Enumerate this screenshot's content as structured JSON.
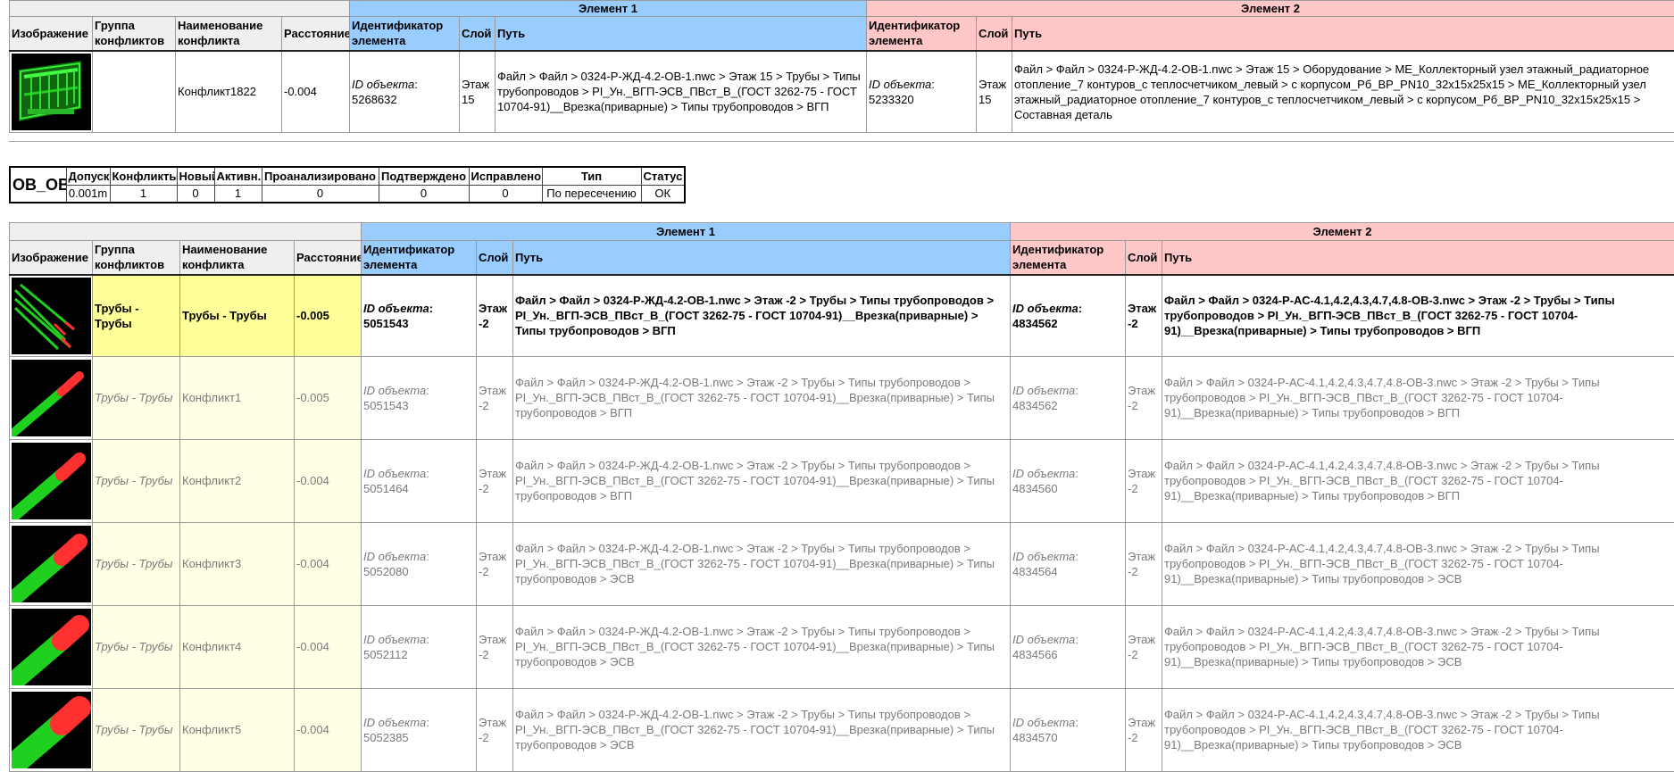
{
  "labels": {
    "element1": "Элемент 1",
    "element2": "Элемент 2",
    "image": "Изображение",
    "group": "Группа конфликтов",
    "name": "Наименование конфликта",
    "distance": "Расстояние",
    "element_id": "Идентификатор элемента",
    "layer": "Слой",
    "path": "Путь",
    "object_id": "ID объекта",
    "colon": ":"
  },
  "top_row": {
    "group": "",
    "name": "Конфликт1822",
    "distance": "-0.004",
    "e1_id": "5268632",
    "e1_layer": "Этаж 15",
    "e1_path": "Файл > Файл > 0324-Р-ЖД-4.2-ОВ-1.nwc > Этаж 15 > Трубы > Типы трубопроводов > PI_Ун._ВГП-ЭСВ_ПВст_В_(ГОСТ 3262-75 - ГОСТ 10704-91)__Врезка(приварные) > Типы трубопроводов > ВГП",
    "e2_id": "5233320",
    "e2_layer": "Этаж 15",
    "e2_path": "Файл > Файл > 0324-Р-ЖД-4.2-ОВ-1.nwc > Этаж 15 > Оборудование > МЕ_Коллекторный узел этажный_радиаторное отопление_7 контуров_с теплосчетчиком_левый > с корпусом_Рб_ВР_PN10_32x15x25x15 > МЕ_Коллекторный узел этажный_радиаторное отопление_7 контуров_с теплосчетчиком_левый > с корпусом_Рб_ВР_PN10_32x15x25x15 > Составная деталь"
  },
  "summary": {
    "name": "ОВ_ОВ",
    "headers": [
      "Допуск",
      "Конфликты",
      "Новый",
      "Активн.",
      "Проанализировано",
      "Подтверждено",
      "Исправлено",
      "Тип",
      "Статус"
    ],
    "values": [
      "0.001m",
      "1",
      "0",
      "1",
      "0",
      "0",
      "0",
      "По пересечению",
      "ОК"
    ]
  },
  "group_row": {
    "group": "Трубы - Трубы",
    "name": "",
    "distance": "-0.005",
    "e1_id": "5051543",
    "e1_layer": "Этаж -2",
    "e1_path": "Файл > Файл > 0324-Р-ЖД-4.2-ОВ-1.nwc > Этаж -2 > Трубы > Типы трубопроводов > PI_Ун._ВГП-ЭСВ_ПВст_В_(ГОСТ 3262-75 - ГОСТ 10704-91)__Врезка(приварные) > Типы трубопроводов > ВГП",
    "e2_id": "4834562",
    "e2_layer": "Этаж -2",
    "e2_path": "Файл > Файл > 0324-Р-АС-4.1,4.2,4.3,4.7,4.8-ОВ-3.nwc > Этаж -2 > Трубы > Типы трубопроводов > PI_Ун._ВГП-ЭСВ_ПВст_В_(ГОСТ 3262-75 - ГОСТ 10704-91)__Врезка(приварные) > Типы трубопроводов > ВГП"
  },
  "rows": [
    {
      "group": "Трубы - Трубы",
      "name": "Конфликт1",
      "distance": "-0.005",
      "e1_id": "5051543",
      "e1_layer": "Этаж -2",
      "e1_path": "Файл > Файл > 0324-Р-ЖД-4.2-ОВ-1.nwc > Этаж -2 > Трубы > Типы трубопроводов > PI_Ун._ВГП-ЭСВ_ПВст_В_(ГОСТ 3262-75 - ГОСТ 10704-91)__Врезка(приварные) > Типы трубопроводов > ВГП",
      "e2_id": "4834562",
      "e2_layer": "Этаж -2",
      "e2_path": "Файл > Файл > 0324-Р-АС-4.1,4.2,4.3,4.7,4.8-ОВ-3.nwc > Этаж -2 > Трубы > Типы трубопроводов > PI_Ун._ВГП-ЭСВ_ПВст_В_(ГОСТ 3262-75 - ГОСТ 10704-91)__Врезка(приварные) > Типы трубопроводов > ВГП"
    },
    {
      "group": "Трубы - Трубы",
      "name": "Конфликт2",
      "distance": "-0.004",
      "e1_id": "5051464",
      "e1_layer": "Этаж -2",
      "e1_path": "Файл > Файл > 0324-Р-ЖД-4.2-ОВ-1.nwc > Этаж -2 > Трубы > Типы трубопроводов > PI_Ун._ВГП-ЭСВ_ПВст_В_(ГОСТ 3262-75 - ГОСТ 10704-91)__Врезка(приварные) > Типы трубопроводов > ВГП",
      "e2_id": "4834560",
      "e2_layer": "Этаж -2",
      "e2_path": "Файл > Файл > 0324-Р-АС-4.1,4.2,4.3,4.7,4.8-ОВ-3.nwc > Этаж -2 > Трубы > Типы трубопроводов > PI_Ун._ВГП-ЭСВ_ПВст_В_(ГОСТ 3262-75 - ГОСТ 10704-91)__Врезка(приварные) > Типы трубопроводов > ВГП"
    },
    {
      "group": "Трубы - Трубы",
      "name": "Конфликт3",
      "distance": "-0.004",
      "e1_id": "5052080",
      "e1_layer": "Этаж -2",
      "e1_path": "Файл > Файл > 0324-Р-ЖД-4.2-ОВ-1.nwc > Этаж -2 > Трубы > Типы трубопроводов > PI_Ун._ВГП-ЭСВ_ПВст_В_(ГОСТ 3262-75 - ГОСТ 10704-91)__Врезка(приварные) > Типы трубопроводов > ЭСВ",
      "e2_id": "4834564",
      "e2_layer": "Этаж -2",
      "e2_path": "Файл > Файл > 0324-Р-АС-4.1,4.2,4.3,4.7,4.8-ОВ-3.nwc > Этаж -2 > Трубы > Типы трубопроводов > PI_Ун._ВГП-ЭСВ_ПВст_В_(ГОСТ 3262-75 - ГОСТ 10704-91)__Врезка(приварные) > Типы трубопроводов > ЭСВ"
    },
    {
      "group": "Трубы - Трубы",
      "name": "Конфликт4",
      "distance": "-0.004",
      "e1_id": "5052112",
      "e1_layer": "Этаж -2",
      "e1_path": "Файл > Файл > 0324-Р-ЖД-4.2-ОВ-1.nwc > Этаж -2 > Трубы > Типы трубопроводов > PI_Ун._ВГП-ЭСВ_ПВст_В_(ГОСТ 3262-75 - ГОСТ 10704-91)__Врезка(приварные) > Типы трубопроводов > ЭСВ",
      "e2_id": "4834566",
      "e2_layer": "Этаж -2",
      "e2_path": "Файл > Файл > 0324-Р-АС-4.1,4.2,4.3,4.7,4.8-ОВ-3.nwc > Этаж -2 > Трубы > Типы трубопроводов > PI_Ун._ВГП-ЭСВ_ПВст_В_(ГОСТ 3262-75 - ГОСТ 10704-91)__Врезка(приварные) > Типы трубопроводов > ЭСВ"
    },
    {
      "group": "Трубы - Трубы",
      "name": "Конфликт5",
      "distance": "-0.004",
      "e1_id": "5052385",
      "e1_layer": "Этаж -2",
      "e1_path": "Файл > Файл > 0324-Р-ЖД-4.2-ОВ-1.nwc > Этаж -2 > Трубы > Типы трубопроводов > PI_Ун._ВГП-ЭСВ_ПВст_В_(ГОСТ 3262-75 - ГОСТ 10704-91)__Врезка(приварные) > Типы трубопроводов > ЭСВ",
      "e2_id": "4834570",
      "e2_layer": "Этаж -2",
      "e2_path": "Файл > Файл > 0324-Р-АС-4.1,4.2,4.3,4.7,4.8-ОВ-3.nwc > Этаж -2 > Трубы > Типы трубопроводов > PI_Ун._ВГП-ЭСВ_ПВст_В_(ГОСТ 3262-75 - ГОСТ 10704-91)__Врезка(приварные) > Типы трубопроводов > ЭСВ"
    }
  ],
  "colors": {
    "element1_header": "#99ccff",
    "element2_header": "#ffc7c7",
    "group_highlight": "#ffff99",
    "row_highlight": "#ffffe6",
    "pipe_green": "#1fd01f",
    "pipe_red": "#ff3030"
  },
  "icons": {
    "top_thumbnail": "collector-3d-thumbnail-icon",
    "group_thumbnail": "pipes-bundle-thumbnail-icon",
    "row_thumbnail": "pipe-clash-thumbnail-icon"
  }
}
